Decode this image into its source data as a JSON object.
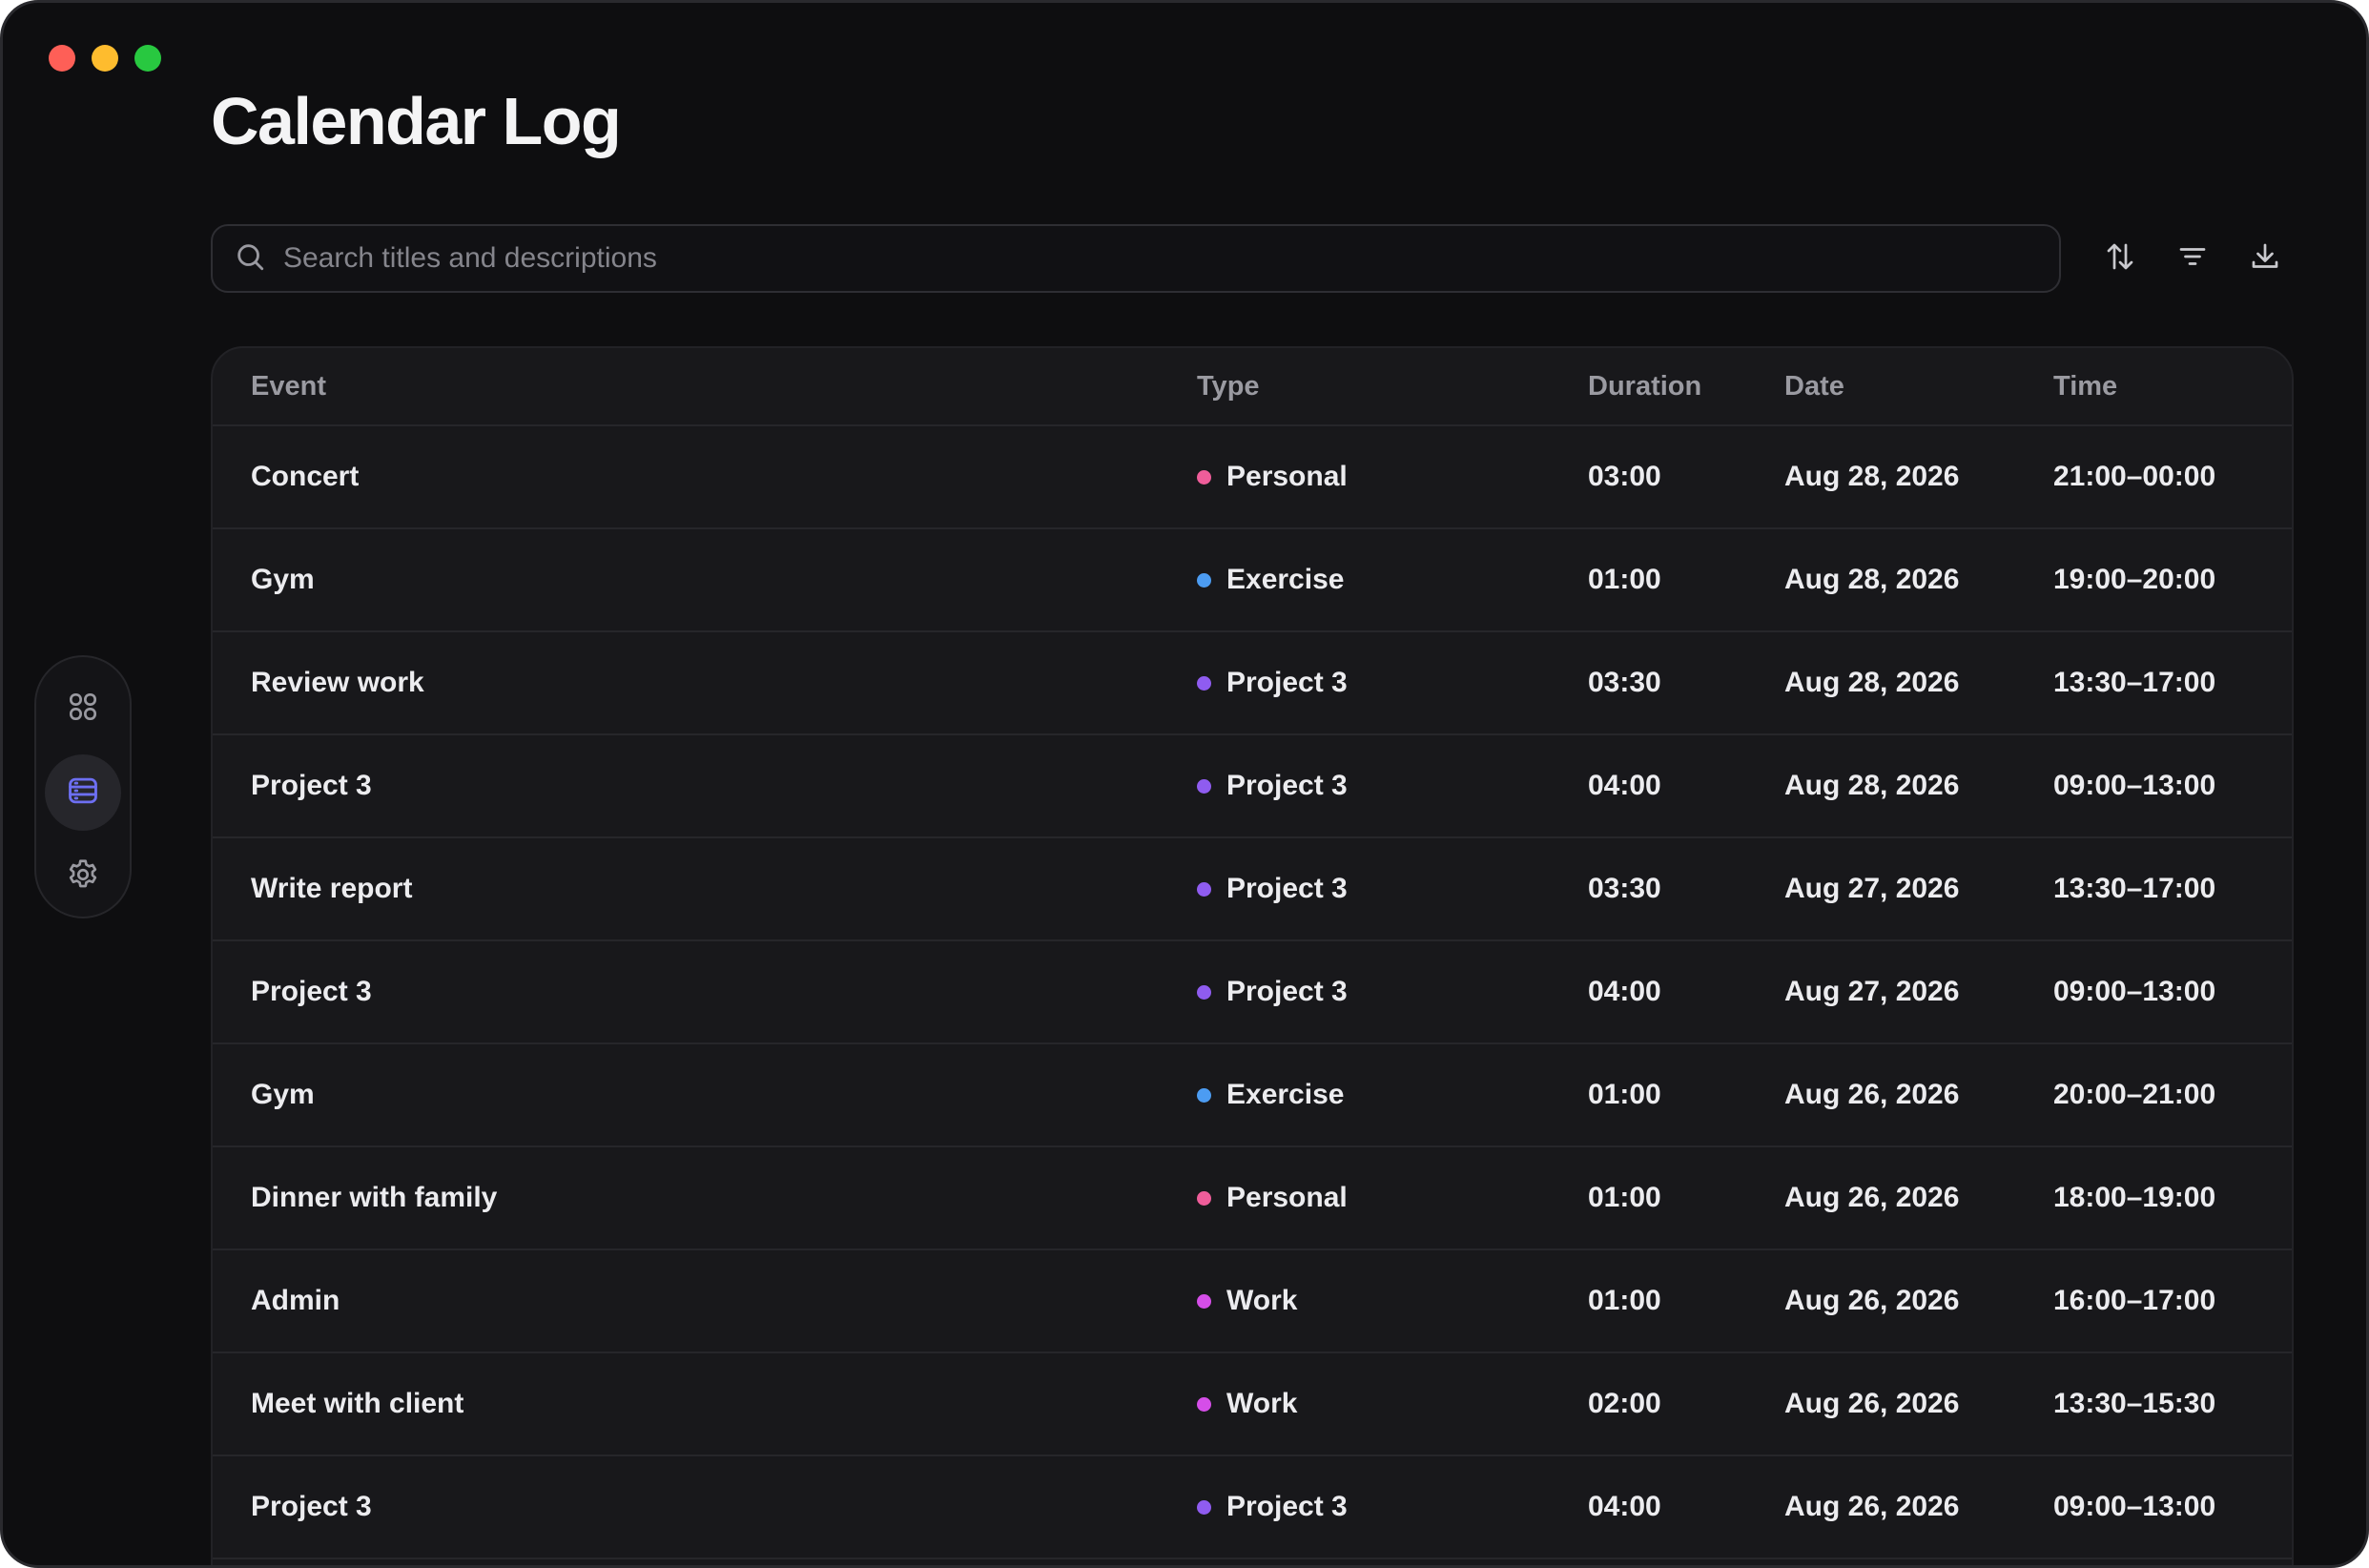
{
  "window": {
    "controls": [
      "close",
      "minimize",
      "zoom"
    ]
  },
  "page": {
    "title": "Calendar Log"
  },
  "search": {
    "placeholder": "Search titles and descriptions",
    "value": ""
  },
  "toolbar": {
    "icons": [
      "sort-icon",
      "filter-icon",
      "download-icon"
    ]
  },
  "sidebar": {
    "items": [
      {
        "icon": "grid-icon",
        "active": false
      },
      {
        "icon": "list-icon",
        "active": true
      },
      {
        "icon": "gear-icon",
        "active": false
      }
    ]
  },
  "colors": {
    "personal": "#ef5d9a",
    "exercise": "#4c9cf2",
    "project": "#8f5cf0",
    "work": "#d54ee8",
    "accent": "#6d6ff2"
  },
  "table": {
    "columns": {
      "event": "Event",
      "type": "Type",
      "duration": "Duration",
      "date": "Date",
      "time": "Time"
    },
    "rows": [
      {
        "event": "Concert",
        "type": "Personal",
        "color": "#ef5d9a",
        "duration": "03:00",
        "date": "Aug 28, 2026",
        "time": "21:00–00:00"
      },
      {
        "event": "Gym",
        "type": "Exercise",
        "color": "#4c9cf2",
        "duration": "01:00",
        "date": "Aug 28, 2026",
        "time": "19:00–20:00"
      },
      {
        "event": "Review work",
        "type": "Project 3",
        "color": "#8f5cf0",
        "duration": "03:30",
        "date": "Aug 28, 2026",
        "time": "13:30–17:00"
      },
      {
        "event": "Project 3",
        "type": "Project 3",
        "color": "#8f5cf0",
        "duration": "04:00",
        "date": "Aug 28, 2026",
        "time": "09:00–13:00"
      },
      {
        "event": "Write report",
        "type": "Project 3",
        "color": "#8f5cf0",
        "duration": "03:30",
        "date": "Aug 27, 2026",
        "time": "13:30–17:00"
      },
      {
        "event": "Project 3",
        "type": "Project 3",
        "color": "#8f5cf0",
        "duration": "04:00",
        "date": "Aug 27, 2026",
        "time": "09:00–13:00"
      },
      {
        "event": "Gym",
        "type": "Exercise",
        "color": "#4c9cf2",
        "duration": "01:00",
        "date": "Aug 26, 2026",
        "time": "20:00–21:00"
      },
      {
        "event": "Dinner with family",
        "type": "Personal",
        "color": "#ef5d9a",
        "duration": "01:00",
        "date": "Aug 26, 2026",
        "time": "18:00–19:00"
      },
      {
        "event": "Admin",
        "type": "Work",
        "color": "#d54ee8",
        "duration": "01:00",
        "date": "Aug 26, 2026",
        "time": "16:00–17:00"
      },
      {
        "event": "Meet with client",
        "type": "Work",
        "color": "#d54ee8",
        "duration": "02:00",
        "date": "Aug 26, 2026",
        "time": "13:30–15:30"
      },
      {
        "event": "Project 3",
        "type": "Project 3",
        "color": "#8f5cf0",
        "duration": "04:00",
        "date": "Aug 26, 2026",
        "time": "09:00–13:00"
      }
    ]
  }
}
